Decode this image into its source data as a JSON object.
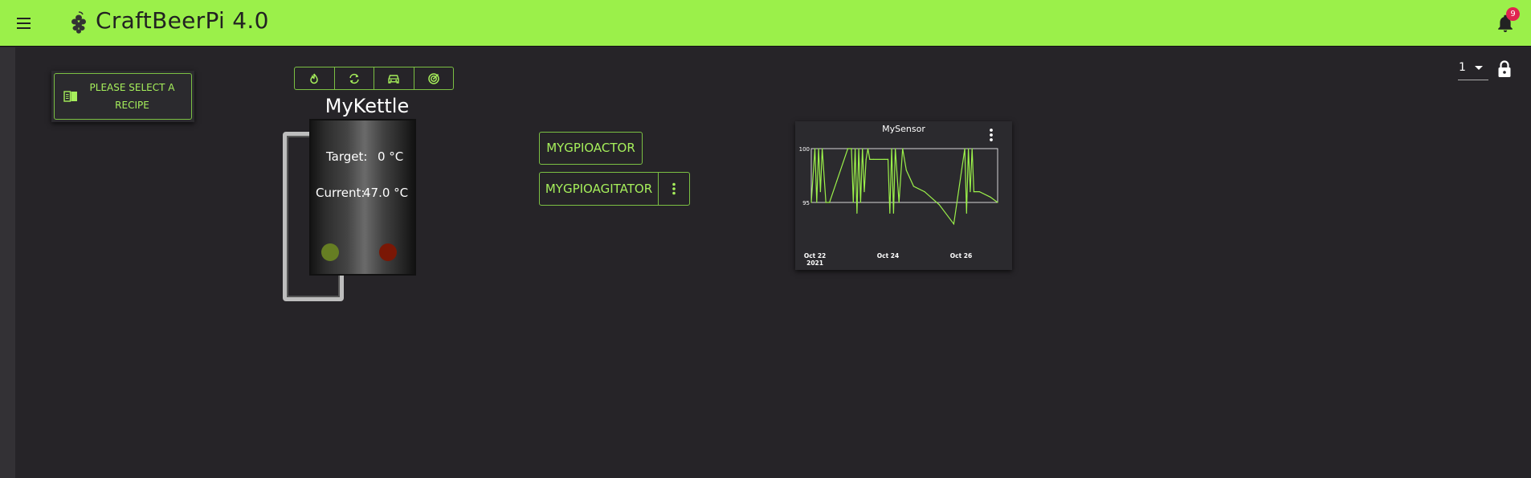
{
  "app": {
    "title": "CraftBeerPi 4.0",
    "notifications_count": "9",
    "menu_icon": "menu-icon",
    "logo_icon": "hop-icon",
    "bell_icon": "bell-icon"
  },
  "toolbar": {
    "page_select_value": "1",
    "lock_icon": "lock-icon"
  },
  "recipe": {
    "button_label_line1": "PLEASE SELECT A",
    "button_label_line2": "RECIPE",
    "icon": "book-icon"
  },
  "kettle": {
    "name": "MyKettle",
    "target_label": "Target:",
    "target_value": "0 °C",
    "current_label": "Current:",
    "current_value": "47.0 °C",
    "controls": [
      "flame-icon",
      "autorenew-icon",
      "car-icon",
      "target-icon"
    ],
    "lamp_colors": [
      "#667e23",
      "#7a1705"
    ]
  },
  "actors": {
    "actor_label": "MYGPIOACTOR",
    "agitator_label": "MYGPIOAGITATOR"
  },
  "colors": {
    "accent": "#9bf04a",
    "background": "#262428",
    "badge": "#e02450"
  },
  "chart_data": {
    "type": "line",
    "title": "MySensor",
    "ylim": [
      95,
      100
    ],
    "yticks": [
      "100",
      "95"
    ],
    "xticks": [
      "Oct 22",
      "Oct 24",
      "Oct 26"
    ],
    "xtick_sub": "2021",
    "series": [
      {
        "x": [
          21.9,
          22.0,
          22.05,
          22.1,
          22.15,
          22.2,
          22.3,
          22.4,
          22.6,
          22.9,
          23.0,
          23.05,
          23.1,
          23.15,
          23.2,
          23.25,
          23.3,
          23.35,
          23.4,
          23.45,
          23.5,
          23.6,
          23.9,
          24.0,
          24.05,
          24.1,
          24.15,
          24.2,
          24.3,
          24.4,
          24.5,
          24.7,
          25.0,
          25.4,
          25.8,
          26.1,
          26.15,
          26.2,
          26.25,
          26.3,
          26.35,
          26.5,
          26.8,
          27.0
        ],
        "y": [
          95,
          100,
          95,
          100,
          96,
          100,
          95,
          95,
          97,
          100,
          100,
          95,
          100,
          94,
          100,
          95,
          100,
          96,
          99,
          100,
          99,
          99,
          99,
          99,
          94,
          100,
          94,
          100,
          95,
          100,
          98,
          96.5,
          96,
          94.8,
          93,
          100,
          94,
          100,
          96,
          100,
          96,
          96,
          95.5,
          95
        ]
      }
    ]
  }
}
